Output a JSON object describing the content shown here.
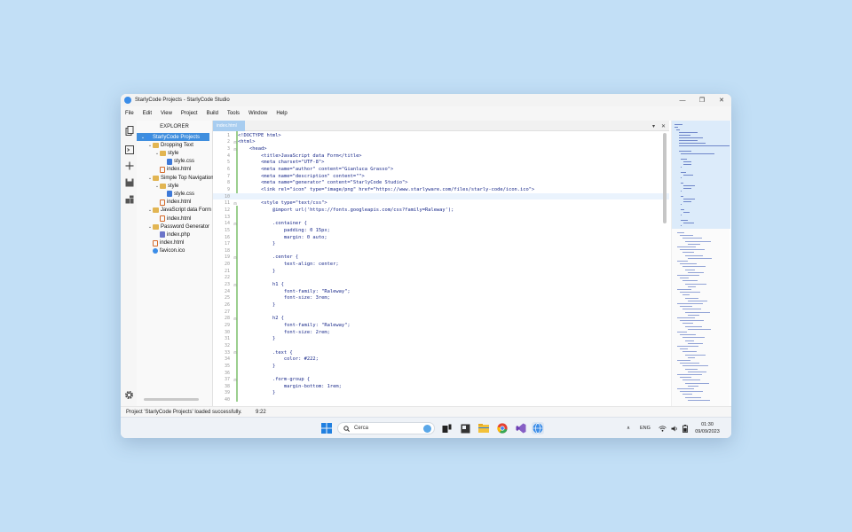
{
  "window": {
    "title": "StarlyCode Projects - StarlyCode Studio",
    "controls": [
      "—",
      "❐",
      "✕"
    ]
  },
  "menu": [
    "File",
    "Edit",
    "View",
    "Project",
    "Build",
    "Tools",
    "Window",
    "Help"
  ],
  "explorer": {
    "header": "EXPLORER",
    "items": [
      {
        "label": "StarlyCode Projects",
        "depth": 0,
        "type": "project",
        "expanded": true,
        "selected": true
      },
      {
        "label": "Dropping Text",
        "depth": 1,
        "type": "folder",
        "expanded": true
      },
      {
        "label": "style",
        "depth": 2,
        "type": "folder",
        "expanded": true
      },
      {
        "label": "style.css",
        "depth": 3,
        "type": "css"
      },
      {
        "label": "index.html",
        "depth": 2,
        "type": "html"
      },
      {
        "label": "Simple Top Navigation",
        "depth": 1,
        "type": "folder",
        "expanded": true
      },
      {
        "label": "style",
        "depth": 2,
        "type": "folder",
        "expanded": true
      },
      {
        "label": "style.css",
        "depth": 3,
        "type": "css"
      },
      {
        "label": "index.html",
        "depth": 2,
        "type": "html"
      },
      {
        "label": "JavaScript data Form",
        "depth": 1,
        "type": "folder",
        "expanded": true
      },
      {
        "label": "index.html",
        "depth": 2,
        "type": "html"
      },
      {
        "label": "Password Generator",
        "depth": 1,
        "type": "folder",
        "expanded": true
      },
      {
        "label": "index.php",
        "depth": 2,
        "type": "php"
      },
      {
        "label": "index.html",
        "depth": 1,
        "type": "html"
      },
      {
        "label": "favicon.ico",
        "depth": 1,
        "type": "ico"
      }
    ]
  },
  "editor": {
    "tab": "index.html",
    "tab_tools": [
      "▾",
      "✕"
    ],
    "current_line": 10,
    "lines": [
      {
        "n": "1",
        "text": "<!DOCTYPE html>",
        "fold": ""
      },
      {
        "n": "2",
        "text": "<html>",
        "fold": "⊟"
      },
      {
        "n": "3",
        "text": "    <head>",
        "fold": "⊟"
      },
      {
        "n": "4",
        "text": "        <title>JavaScript data Form</title>",
        "fold": ""
      },
      {
        "n": "5",
        "text": "        <meta charset=\"UTF-8\">",
        "fold": ""
      },
      {
        "n": "6",
        "text": "        <meta name=\"author\" content=\"Gianluca Grasso\">",
        "fold": ""
      },
      {
        "n": "7",
        "text": "        <meta name=\"description\" content=\"\">",
        "fold": ""
      },
      {
        "n": "8",
        "text": "        <meta name=\"generator\" content=\"StarlyCode Studio\">",
        "fold": ""
      },
      {
        "n": "9",
        "text": "        <link rel=\"icon\" type=\"image/png\" href=\"https://www.starlyware.com/files/starly-code/icon.ico\">",
        "fold": ""
      },
      {
        "n": "10",
        "text": "",
        "fold": ""
      },
      {
        "n": "11",
        "text": "        <style type=\"text/css\">",
        "fold": "⊟"
      },
      {
        "n": "12",
        "text": "            @import url('https://fonts.googleapis.com/css?family=Raleway');",
        "fold": ""
      },
      {
        "n": "13",
        "text": "",
        "fold": ""
      },
      {
        "n": "14",
        "text": "            .container {",
        "fold": "⊟"
      },
      {
        "n": "15",
        "text": "                padding: 0 15px;",
        "fold": ""
      },
      {
        "n": "16",
        "text": "                margin: 0 auto;",
        "fold": ""
      },
      {
        "n": "17",
        "text": "            }",
        "fold": ""
      },
      {
        "n": "18",
        "text": "",
        "fold": ""
      },
      {
        "n": "19",
        "text": "            .center {",
        "fold": "⊟"
      },
      {
        "n": "20",
        "text": "                text-align: center;",
        "fold": ""
      },
      {
        "n": "21",
        "text": "            }",
        "fold": ""
      },
      {
        "n": "22",
        "text": "",
        "fold": ""
      },
      {
        "n": "23",
        "text": "            h1 {",
        "fold": "⊟"
      },
      {
        "n": "24",
        "text": "                font-family: \"Raleway\";",
        "fold": ""
      },
      {
        "n": "25",
        "text": "                font-size: 3rem;",
        "fold": ""
      },
      {
        "n": "26",
        "text": "            }",
        "fold": ""
      },
      {
        "n": "27",
        "text": "",
        "fold": ""
      },
      {
        "n": "28",
        "text": "            h2 {",
        "fold": "⊟"
      },
      {
        "n": "29",
        "text": "                font-family: \"Raleway\";",
        "fold": ""
      },
      {
        "n": "30",
        "text": "                font-size: 2rem;",
        "fold": ""
      },
      {
        "n": "31",
        "text": "            }",
        "fold": ""
      },
      {
        "n": "32",
        "text": "",
        "fold": ""
      },
      {
        "n": "33",
        "text": "            .text {",
        "fold": "⊟"
      },
      {
        "n": "34",
        "text": "                color: #222;",
        "fold": ""
      },
      {
        "n": "35",
        "text": "            }",
        "fold": ""
      },
      {
        "n": "36",
        "text": "",
        "fold": ""
      },
      {
        "n": "37",
        "text": "            .form-group {",
        "fold": "⊟"
      },
      {
        "n": "38",
        "text": "                margin-bottom: 1rem;",
        "fold": ""
      },
      {
        "n": "39",
        "text": "            }",
        "fold": ""
      },
      {
        "n": "40",
        "text": "",
        "fold": ""
      }
    ]
  },
  "status": {
    "message": "Project 'StarlyCode Projects' loaded successfully.",
    "position": "9:22"
  },
  "taskbar": {
    "search_label": "Cerca",
    "language": "ENG",
    "time": "01:30",
    "date": "09/09/2023",
    "tray_chevron": "∧"
  },
  "colors": {
    "accent": "#3f8ede",
    "folder": "#e2b552",
    "code": "#1a2a8a",
    "modified_gutter": "#9ccf8f"
  }
}
